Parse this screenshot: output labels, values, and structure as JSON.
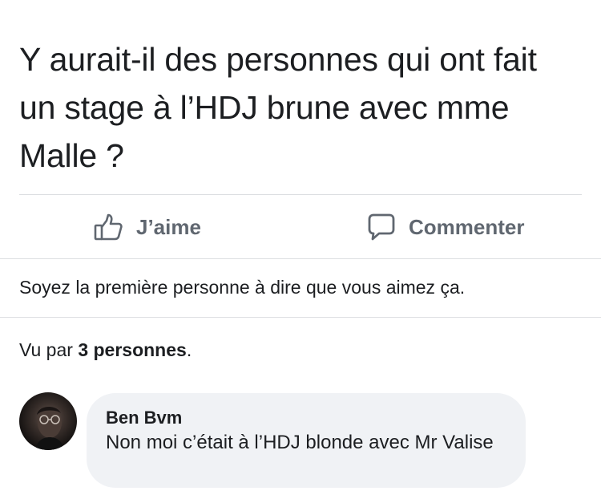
{
  "post": {
    "text": "Y aurait-il des personnes qui ont fait un stage à l’HDJ brune avec mme Malle ?"
  },
  "actions": {
    "like_label": "J’aime",
    "like_icon": "thumbs-up-icon",
    "comment_label": "Commenter",
    "comment_icon": "speech-bubble-icon"
  },
  "likes": {
    "text": "Soyez la première personne à dire que vous aimez ça."
  },
  "seen": {
    "prefix": "Vu par ",
    "count_text": "3 personnes",
    "suffix": "."
  },
  "comment": {
    "author": "Ben Bvm",
    "text": "Non moi c’était à l’HDJ blonde avec Mr Valise"
  },
  "colors": {
    "text": "#1c1e21",
    "secondary": "#606770",
    "divider": "#dddfe2",
    "bubble": "#f0f2f5"
  }
}
